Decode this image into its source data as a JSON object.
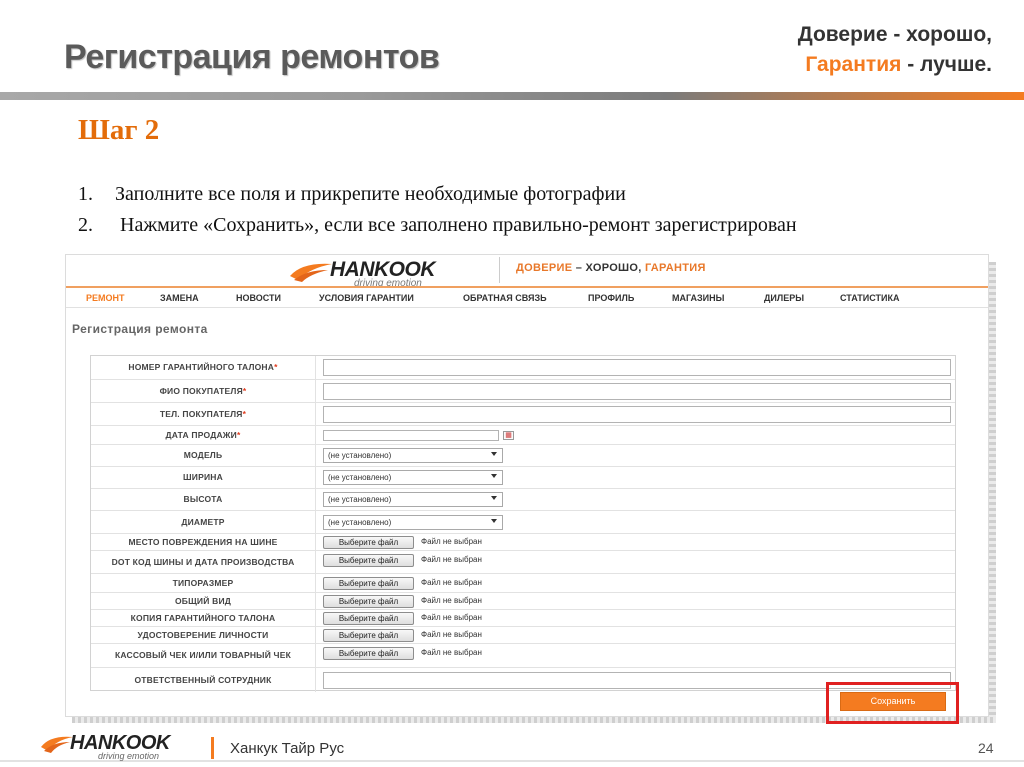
{
  "slide": {
    "title": "Регистрация ремонтов",
    "slogan_line1": "Доверие - хорошо,",
    "slogan_line2_highlight": "Гарантия",
    "slogan_line2_rest": " - лучше.",
    "step_title": "Шаг 2",
    "instructions": [
      {
        "num": "1.",
        "text": "Заполните все  поля и прикрепите необходимые фотографии"
      },
      {
        "num": "2.",
        "text": " Нажмите «Сохранить», если все заполнено правильно-ремонт зарегистрирован"
      }
    ]
  },
  "site": {
    "logo_text": "HANKOOK",
    "logo_tagline": "driving emotion",
    "slogan_part1": "ДОВЕРИЕ",
    "slogan_part2": " – ХОРОШО, ",
    "slogan_part3": "ГАРАНТИЯ",
    "nav": [
      "РЕМОНТ",
      "ЗАМЕНА",
      "НОВОСТИ",
      "УСЛОВИЯ ГАРАНТИИ",
      "ОБРАТНАЯ СВЯЗЬ",
      "ПРОФИЛЬ",
      "МАГАЗИНЫ",
      "ДИЛЕРЫ",
      "СТАТИСТИКА"
    ],
    "active_nav": "РЕМОНТ",
    "form_title": "Регистрация ремонта",
    "fields": {
      "warranty_number": "НОМЕР ГАРАНТИЙНОГО ТАЛОНА",
      "buyer_name": "ФИО ПОКУПАТЕЛЯ",
      "buyer_phone": "ТЕЛ. ПОКУПАТЕЛЯ",
      "sale_date": "ДАТА ПРОДАЖИ",
      "model": "МОДЕЛЬ",
      "width": "ШИРИНА",
      "height": "ВЫСОТА",
      "diameter": "ДИАМЕТР",
      "damage_place": "МЕСТО ПОВРЕЖДЕНИЯ НА ШИНЕ",
      "dot_code": "DOT КОД ШИНЫ И ДАТА ПРОИЗВОДСТВА",
      "tire_size": "ТИПОРАЗМЕР",
      "general_view": "ОБЩИЙ ВИД",
      "warranty_copy": "КОПИЯ ГАРАНТИЙНОГО ТАЛОНА",
      "id_document": "УДОСТОВЕРЕНИЕ ЛИЧНОСТИ",
      "receipt": "КАССОВЫЙ ЧЕК И/ИЛИ ТОВАРНЫЙ ЧЕК",
      "employee": "ОТВЕТСТВЕННЫЙ СОТРУДНИК"
    },
    "required_mark": "*",
    "calendar_icon": "calendar-icon",
    "select_placeholder": "(не установлено)",
    "file_button": "Выберите файл",
    "file_none": "Файл не выбран",
    "save_button": "Сохранить"
  },
  "footer": {
    "logo_text": "HANKOOK",
    "logo_tagline": "driving emotion",
    "company": "Ханкук Тайр Рус",
    "page_number": "24"
  },
  "colors": {
    "accent": "#f47b20",
    "heading_gray": "#5a5a5a",
    "highlight_red": "#e02020",
    "step_orange": "#e36c0a"
  }
}
